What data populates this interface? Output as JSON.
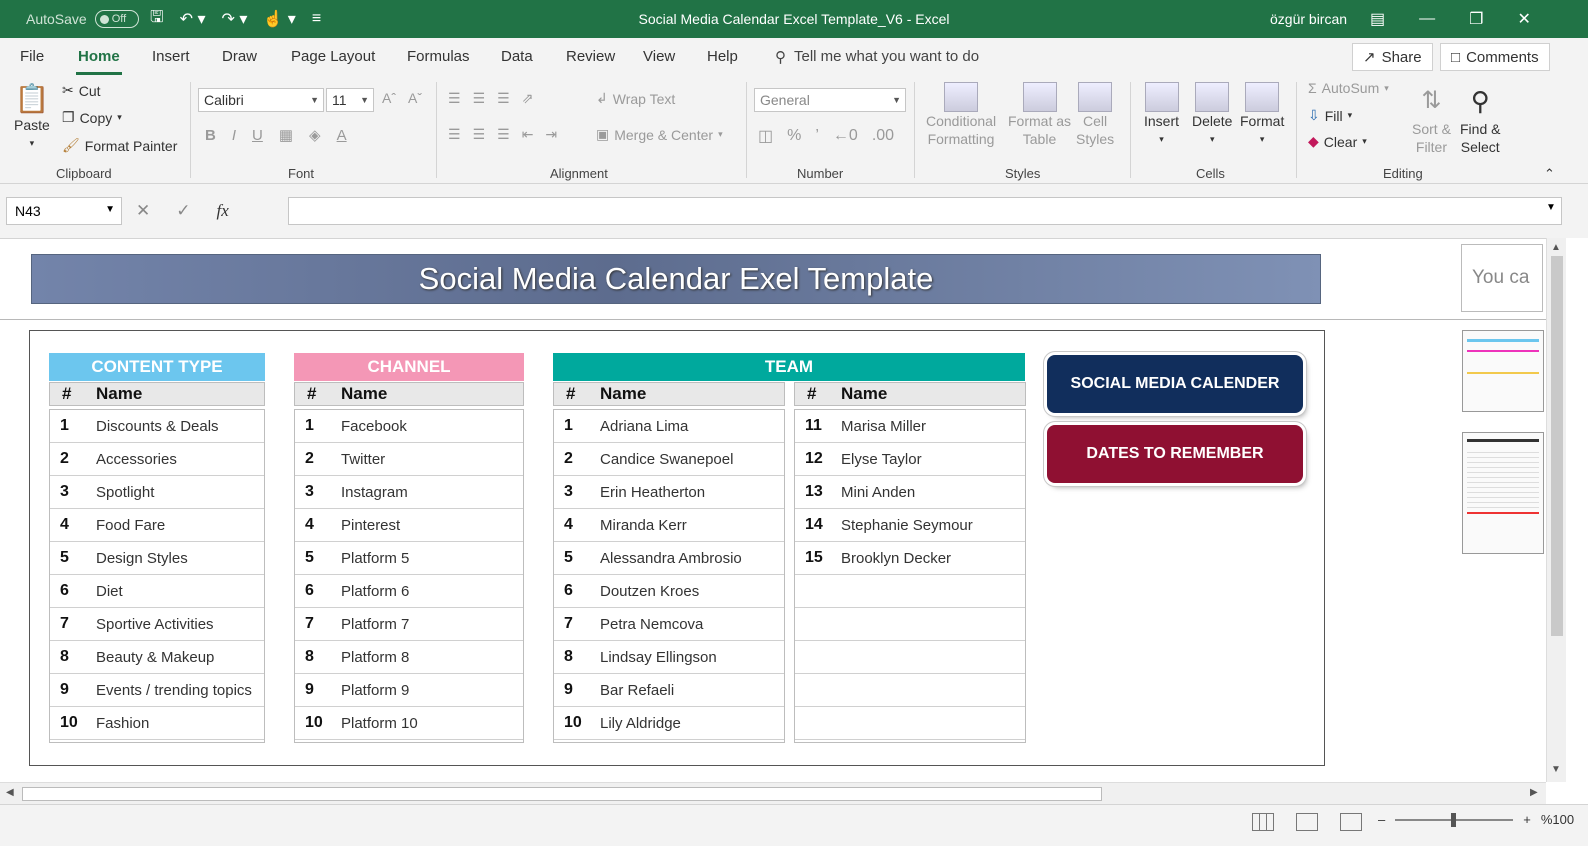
{
  "titlebar": {
    "autosave_label": "AutoSave",
    "autosave_state": "Off",
    "doc_title": "Social Media Calendar Excel Template_V6  -  Excel",
    "user": "özgür bircan"
  },
  "menu": {
    "items": [
      "File",
      "Home",
      "Insert",
      "Draw",
      "Page Layout",
      "Formulas",
      "Data",
      "Review",
      "View",
      "Help"
    ],
    "active": "Home",
    "tell_me": "Tell me what you want to do",
    "share": "Share",
    "comments": "Comments"
  },
  "ribbon": {
    "clipboard": {
      "paste": "Paste",
      "cut": "Cut",
      "copy": "Copy",
      "format_painter": "Format Painter",
      "label": "Clipboard"
    },
    "font": {
      "name": "Calibri",
      "size": "11",
      "label": "Font"
    },
    "alignment": {
      "wrap_text": "Wrap Text",
      "merge_center": "Merge & Center",
      "label": "Alignment"
    },
    "number": {
      "format": "General",
      "label": "Number"
    },
    "styles": {
      "conditional_1": "Conditional",
      "conditional_2": "Formatting",
      "format_table_1": "Format as",
      "format_table_2": "Table",
      "cell_styles_1": "Cell",
      "cell_styles_2": "Styles",
      "label": "Styles"
    },
    "cells": {
      "insert": "Insert",
      "delete": "Delete",
      "format": "Format",
      "label": "Cells"
    },
    "editing": {
      "autosum": "AutoSum",
      "fill": "Fill",
      "clear": "Clear",
      "sort_1": "Sort &",
      "sort_2": "Filter",
      "find_1": "Find &",
      "find_2": "Select",
      "label": "Editing"
    }
  },
  "formula_bar": {
    "name_box": "N43",
    "fx": "fx",
    "formula": ""
  },
  "sheet": {
    "banner_title": "Social Media Calendar Exel Template",
    "side_pane_text": "You ca",
    "col_hash": "#",
    "col_name": "Name",
    "content_type": {
      "title": "CONTENT TYPE",
      "rows": [
        {
          "n": "1",
          "name": "Discounts & Deals"
        },
        {
          "n": "2",
          "name": "Accessories"
        },
        {
          "n": "3",
          "name": "Spotlight"
        },
        {
          "n": "4",
          "name": "Food Fare"
        },
        {
          "n": "5",
          "name": "Design Styles"
        },
        {
          "n": "6",
          "name": "Diet"
        },
        {
          "n": "7",
          "name": "Sportive Activities"
        },
        {
          "n": "8",
          "name": "Beauty & Makeup"
        },
        {
          "n": "9",
          "name": "Events / trending topics"
        },
        {
          "n": "10",
          "name": "Fashion"
        }
      ]
    },
    "channel": {
      "title": "CHANNEL",
      "rows": [
        {
          "n": "1",
          "name": "Facebook"
        },
        {
          "n": "2",
          "name": "Twitter"
        },
        {
          "n": "3",
          "name": "Instagram"
        },
        {
          "n": "4",
          "name": "Pinterest"
        },
        {
          "n": "5",
          "name": "Platform 5"
        },
        {
          "n": "6",
          "name": "Platform 6"
        },
        {
          "n": "7",
          "name": "Platform 7"
        },
        {
          "n": "8",
          "name": "Platform 8"
        },
        {
          "n": "9",
          "name": "Platform 9"
        },
        {
          "n": "10",
          "name": "Platform 10"
        }
      ]
    },
    "team": {
      "title": "TEAM",
      "rows_a": [
        {
          "n": "1",
          "name": "Adriana Lima"
        },
        {
          "n": "2",
          "name": "Candice Swanepoel"
        },
        {
          "n": "3",
          "name": "Erin Heatherton"
        },
        {
          "n": "4",
          "name": "Miranda Kerr"
        },
        {
          "n": "5",
          "name": "Alessandra Ambrosio"
        },
        {
          "n": "6",
          "name": "Doutzen Kroes"
        },
        {
          "n": "7",
          "name": "Petra Nemcova"
        },
        {
          "n": "8",
          "name": "Lindsay Ellingson"
        },
        {
          "n": "9",
          "name": "Bar Refaeli"
        },
        {
          "n": "10",
          "name": "Lily Aldridge"
        }
      ],
      "rows_b": [
        {
          "n": "11",
          "name": "Marisa Miller"
        },
        {
          "n": "12",
          "name": "Elyse Taylor"
        },
        {
          "n": "13",
          "name": "Mini Anden"
        },
        {
          "n": "14",
          "name": "Stephanie Seymour"
        },
        {
          "n": "15",
          "name": "Brooklyn Decker"
        },
        {
          "n": "",
          "name": ""
        },
        {
          "n": "",
          "name": ""
        },
        {
          "n": "",
          "name": ""
        },
        {
          "n": "",
          "name": ""
        },
        {
          "n": "",
          "name": ""
        }
      ]
    },
    "buttons": {
      "calendar": "SOCIAL MEDIA CALENDER",
      "dates": "DATES TO REMEMBER"
    }
  },
  "status": {
    "zoom_minus": "–",
    "zoom_plus": "+",
    "zoom": "%100"
  },
  "colors": {
    "excel_green": "#217346",
    "content_type_header": "#6cc6ee",
    "channel_header": "#f497b6",
    "team_header": "#00a99d",
    "calendar_button": "#112e5c",
    "dates_button": "#8f1032"
  }
}
